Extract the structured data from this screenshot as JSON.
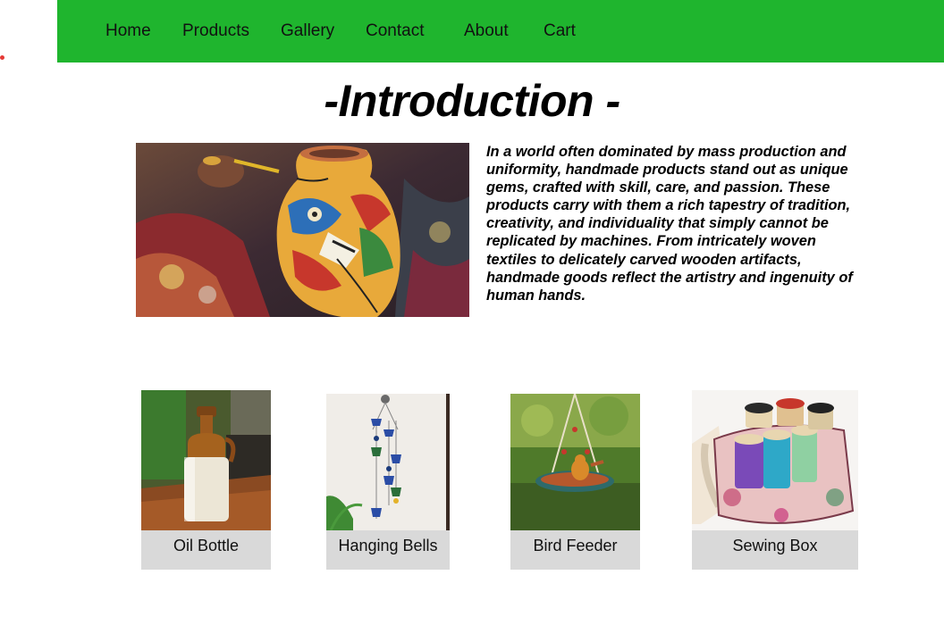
{
  "nav": {
    "items": [
      {
        "label": "Home"
      },
      {
        "label": "Products"
      },
      {
        "label": "Gallery"
      },
      {
        "label": "Contact"
      },
      {
        "label": "About"
      },
      {
        "label": "Cart"
      }
    ]
  },
  "main": {
    "title": "-Introduction -",
    "intro_image": "painted-clay-pot-photo",
    "intro_text": "In a world often dominated by mass production and uniformity, handmade products stand out as unique gems, crafted with skill, care, and passion. These products carry with them a rich tapestry of tradition, creativity, and individuality that simply cannot be replicated by machines. From intricately woven textiles to delicately carved wooden artifacts, handmade goods reflect the artistry and ingenuity of human hands."
  },
  "products": [
    {
      "name": "Oil Bottle",
      "image": "oil-bottle-photo"
    },
    {
      "name": "Hanging Bells",
      "image": "hanging-bells-photo"
    },
    {
      "name": "Bird Feeder",
      "image": "bird-feeder-photo"
    },
    {
      "name": "Sewing Box",
      "image": "sewing-box-photo"
    }
  ],
  "colors": {
    "nav_bg": "#1fb52e",
    "label_bg": "#d9d9d9",
    "accent_dot": "#e53935"
  }
}
